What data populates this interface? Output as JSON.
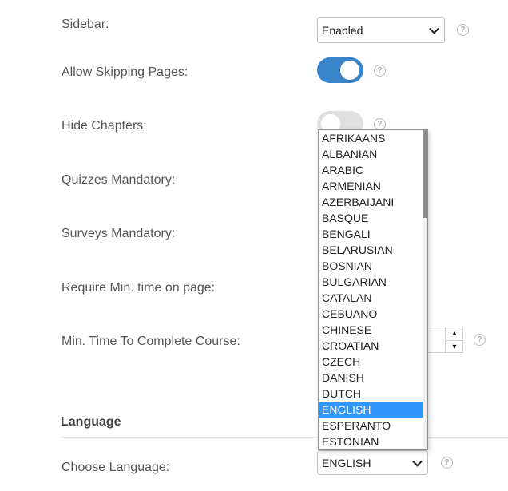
{
  "settings": {
    "sidebar": {
      "label": "Sidebar:",
      "value": "Enabled"
    },
    "allow_skipping_pages": {
      "label": "Allow Skipping Pages:",
      "enabled": true
    },
    "hide_chapters": {
      "label": "Hide Chapters:",
      "enabled": false
    },
    "quizzes_mandatory": {
      "label": "Quizzes Mandatory:"
    },
    "surveys_mandatory": {
      "label": "Surveys Mandatory:"
    },
    "require_min_time": {
      "label": "Require Min. time on page:"
    },
    "min_time_to_complete": {
      "label": "Min. Time To Complete Course:",
      "value": ""
    }
  },
  "language_section": {
    "title": "Language",
    "choose_label": "Choose Language:",
    "selected": "ENGLISH",
    "options": [
      "AFRIKAANS",
      "ALBANIAN",
      "ARABIC",
      "ARMENIAN",
      "AZERBAIJANI",
      "BASQUE",
      "BENGALI",
      "BELARUSIAN",
      "BOSNIAN",
      "BULGARIAN",
      "CATALAN",
      "CEBUANO",
      "CHINESE",
      "CROATIAN",
      "CZECH",
      "DANISH",
      "DUTCH",
      "ENGLISH",
      "ESPERANTO",
      "ESTONIAN"
    ]
  },
  "icons": {
    "help": "?",
    "stepper_up": "▲",
    "stepper_down": "▼"
  },
  "colors": {
    "toggle_on": "#3a84c9",
    "toggle_off": "#e0e0e0",
    "selected_option": "#3297fd"
  }
}
